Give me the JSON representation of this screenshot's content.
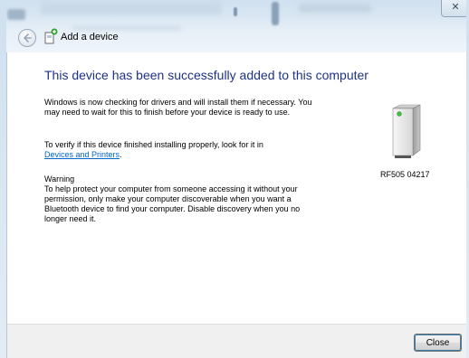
{
  "window": {
    "title": "Add a device",
    "close_glyph": "✕"
  },
  "content": {
    "heading": "This device has been successfully added to this computer",
    "para1": "Windows is now checking for drivers and will install them if necessary. You may need to wait for this to finish before your device is ready to use.",
    "para2_text": "To verify if this device finished installing properly, look for it in",
    "para2_link": "Devices and Printers",
    "para2_suffix": ".",
    "warning_title": "Warning",
    "warning_text": "To help protect your computer from someone accessing it without your permission, only make your computer discoverable when you want a Bluetooth device to find your computer. Disable discovery when you no longer need it."
  },
  "device": {
    "name": "RF505 04217",
    "icon": "device-tower-icon"
  },
  "footer": {
    "close_label": "Close"
  },
  "icons": {
    "back": "back-arrow-icon",
    "title": "add-device-icon"
  }
}
